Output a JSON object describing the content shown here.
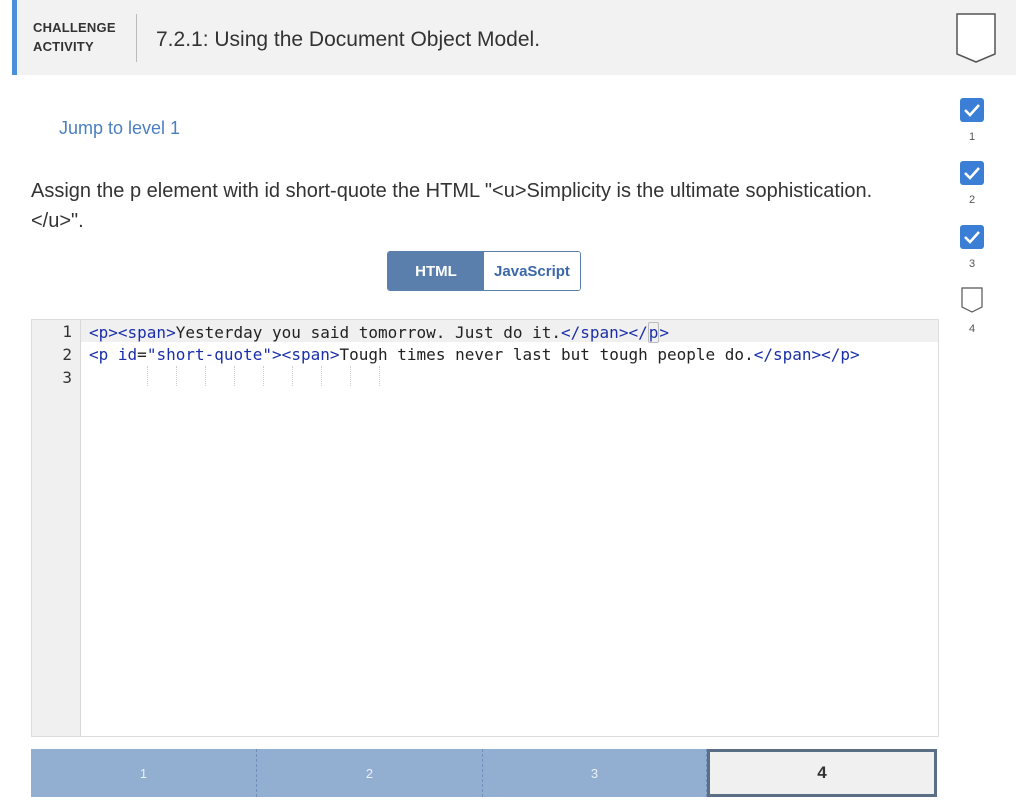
{
  "header": {
    "badge_line1": "CHALLENGE",
    "badge_line2": "ACTIVITY",
    "title": "7.2.1: Using the Document Object Model."
  },
  "jump_link": "Jump to level 1",
  "prompt": "Assign the p element with id short-quote the HTML \"<u>Simplicity is the ultimate sophistication.</u>\".",
  "tabs": {
    "active": "HTML",
    "inactive": "JavaScript"
  },
  "editor": {
    "line_numbers": [
      "1",
      "2",
      "3"
    ],
    "line1": {
      "tag_open": "<p><span>",
      "text": "Yesterday you said tomorrow. Just do it.",
      "tag_close_a": "</span></",
      "tag_close_b": "p",
      "tag_close_c": ">"
    },
    "line2": {
      "tag_p": "<p ",
      "attr": "id",
      "eq": "=",
      "val": "\"short-quote\"",
      "tag_rest": "><span>",
      "text": "Tough times never last but tough people do.",
      "tag_close": "</span></p>"
    }
  },
  "progress": {
    "segments": [
      "1",
      "2",
      "3",
      "4"
    ],
    "current": 4
  },
  "levels": [
    {
      "num": "1",
      "done": true
    },
    {
      "num": "2",
      "done": true
    },
    {
      "num": "3",
      "done": true
    },
    {
      "num": "4",
      "done": false
    }
  ],
  "colors": {
    "accent": "#4a90d9",
    "check": "#3a7fd5",
    "progress": "#92afd1"
  }
}
